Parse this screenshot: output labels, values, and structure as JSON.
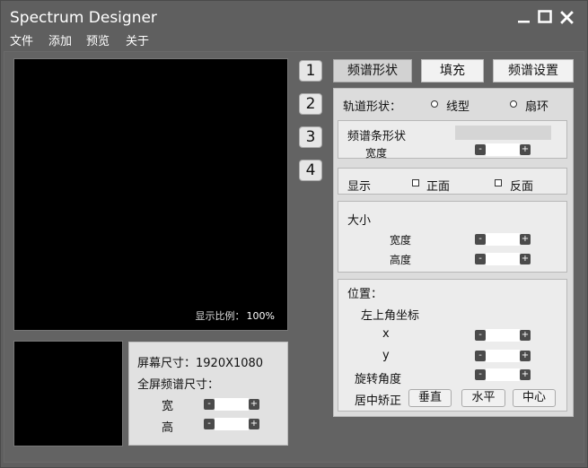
{
  "window": {
    "title": "Spectrum Designer"
  },
  "menu": {
    "file": "文件",
    "add": "添加",
    "preview": "预览",
    "about": "关于"
  },
  "preview": {
    "ratio_label": "显示比例：",
    "ratio_value": "100%"
  },
  "screen_info": {
    "size_label": "屏幕尺寸：1920X1080",
    "fullscreen_label": "全屏频谱尺寸：",
    "width_label": "宽",
    "height_label": "高"
  },
  "step_tabs": [
    "1",
    "2",
    "3",
    "4"
  ],
  "tabs": {
    "shape": "频谱形状",
    "fill": "填充",
    "settings": "频谱设置"
  },
  "track": {
    "label": "轨道形状：",
    "option_linear": "线型",
    "option_ring": "扇环"
  },
  "bar": {
    "shape_label": "频谱条形状",
    "width_label": "宽度"
  },
  "display": {
    "label": "显示",
    "front": "正面",
    "back": "反面"
  },
  "size": {
    "label": "大小",
    "width_label": "宽度",
    "height_label": "高度"
  },
  "position": {
    "label": "位置：",
    "corner_label": "左上角坐标",
    "x_label": "x",
    "y_label": "y",
    "rotation_label": "旋转角度",
    "center_label": "居中矫正",
    "vertical_button": "垂直",
    "horizontal_button": "水平",
    "center_button": "中心"
  },
  "icons": {
    "minimize": "minimize-icon",
    "maximize": "maximize-icon",
    "close": "close-icon",
    "minus": "minus-icon",
    "plus": "plus-icon"
  }
}
